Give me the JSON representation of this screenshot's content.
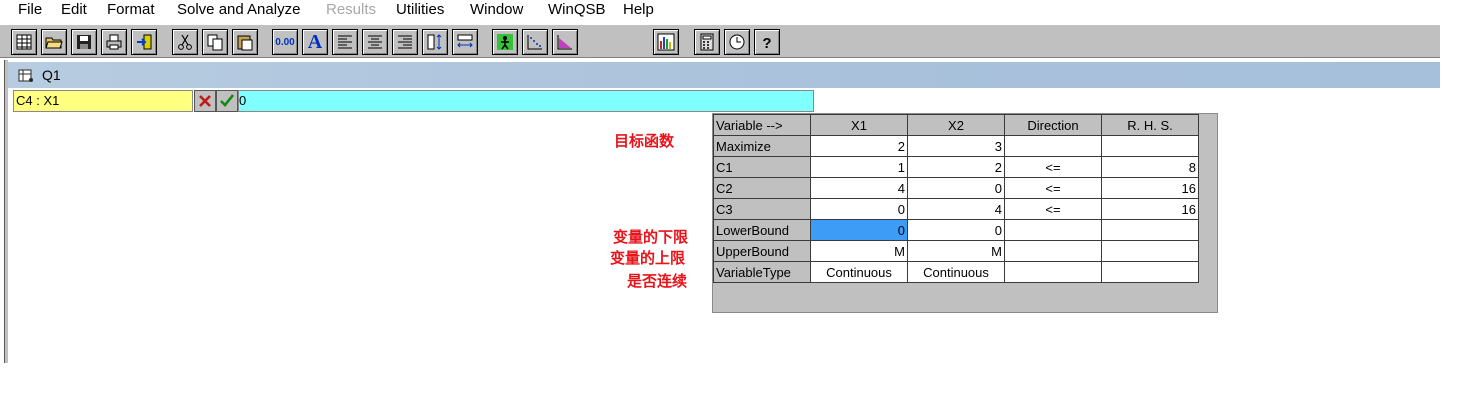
{
  "menu": {
    "items": [
      "File",
      "Edit",
      "Format",
      "Solve and Analyze",
      "Results",
      "Utilities",
      "Window",
      "WinQSB",
      "Help"
    ],
    "disabled": [
      "Results"
    ]
  },
  "toolbar": {
    "buttons": [
      "new-grid-icon",
      "open-folder-icon",
      "save-disk-icon",
      "print-icon",
      "exit-icon",
      "cut-icon",
      "copy-icon",
      "paste-icon",
      "number-format-icon",
      "font-icon",
      "align-left-icon",
      "align-center-icon",
      "align-right-icon",
      "row-height-icon",
      "column-width-icon",
      "solve-icon",
      "graphic-method-icon",
      "feasible-region-icon",
      "bar-chart-icon",
      "calculator-icon",
      "clock-icon",
      "help-icon"
    ],
    "number_format_label": "0.00",
    "font_label": "A"
  },
  "window": {
    "title": "Q1"
  },
  "cell_edit": {
    "reference": "C4 : X1",
    "value": "0"
  },
  "annotations": {
    "objective": "目标函数",
    "lower_bound": "变量的下限",
    "upper_bound": "变量的上限",
    "variable_type": "是否连续"
  },
  "grid": {
    "headers": [
      "Variable -->",
      "X1",
      "X2",
      "Direction",
      "R. H. S."
    ],
    "rows": [
      {
        "label": "Maximize",
        "cells": [
          "2",
          "3",
          "",
          ""
        ]
      },
      {
        "label": "C1",
        "cells": [
          "1",
          "2",
          "<=",
          "8"
        ]
      },
      {
        "label": "C2",
        "cells": [
          "4",
          "0",
          "<=",
          "16"
        ]
      },
      {
        "label": "C3",
        "cells": [
          "0",
          "4",
          "<=",
          "16"
        ]
      },
      {
        "label": "LowerBound",
        "cells": [
          "0",
          "0",
          "",
          ""
        ]
      },
      {
        "label": "UpperBound",
        "cells": [
          "M",
          "M",
          "",
          ""
        ]
      },
      {
        "label": "VariableType",
        "cells": [
          "Continuous",
          "Continuous",
          "",
          ""
        ]
      }
    ],
    "selected_cell": "C4 : X1",
    "colors": {
      "selected": "#3d9cf5",
      "header_gray": "#c0c0c0"
    }
  },
  "colors": {
    "cell_ref_bg": "#ffff80",
    "cell_input_bg": "#80ffff",
    "annotation_red": "#e8141b",
    "title_bar": "#a9c1db"
  }
}
